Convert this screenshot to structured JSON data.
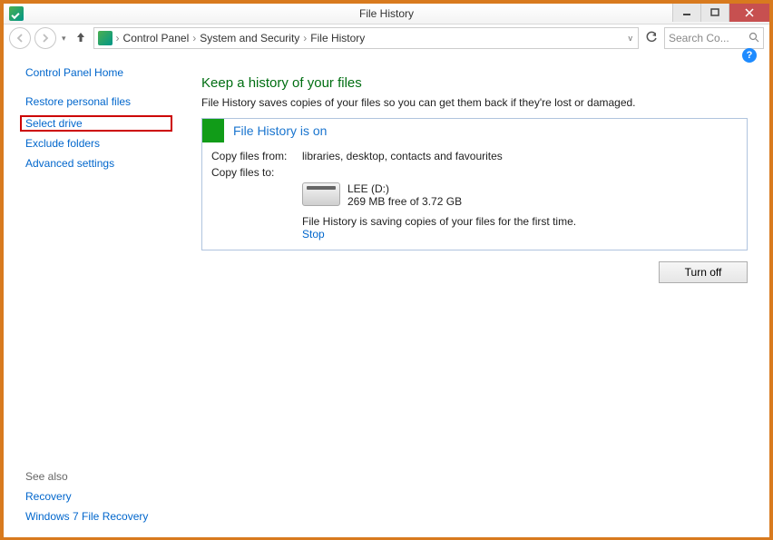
{
  "window": {
    "title": "File History"
  },
  "breadcrumb": {
    "root": "Control Panel",
    "mid": "System and Security",
    "leaf": "File History"
  },
  "search": {
    "placeholder": "Search Co..."
  },
  "sidebar": {
    "home": "Control Panel Home",
    "items": [
      "Restore personal files",
      "Select drive",
      "Exclude folders",
      "Advanced settings"
    ],
    "see_also_label": "See also",
    "see_also": [
      "Recovery",
      "Windows 7 File Recovery"
    ]
  },
  "main": {
    "heading": "Keep a history of your files",
    "subtext": "File History saves copies of your files so you can get them back if they're lost or damaged.",
    "status": "File History is on",
    "copy_from_label": "Copy files from:",
    "copy_from_value": "libraries, desktop, contacts and favourites",
    "copy_to_label": "Copy files to:",
    "drive_name": "LEE (D:)",
    "drive_space": "269 MB free of 3.72 GB",
    "saving_text": "File History is saving copies of your files for the first time.",
    "stop_label": "Stop",
    "turn_off_label": "Turn off"
  }
}
